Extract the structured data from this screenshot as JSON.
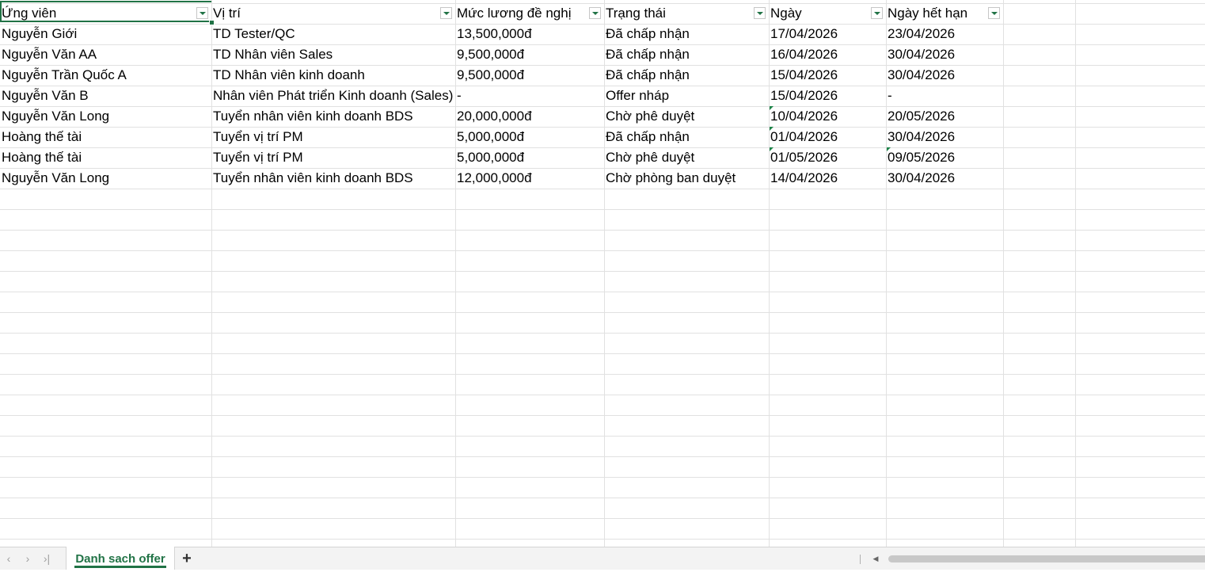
{
  "headers": [
    {
      "label": "Ứng viên"
    },
    {
      "label": "Vị trí"
    },
    {
      "label": "Mức lương đề nghị"
    },
    {
      "label": "Trạng thái"
    },
    {
      "label": "Ngày"
    },
    {
      "label": "Ngày hết hạn"
    }
  ],
  "rows": [
    {
      "cells": [
        "Nguyễn Giới",
        "TD Tester/QC",
        "13,500,000đ",
        "Đã chấp nhận",
        "17/04/2026",
        "23/04/2026"
      ]
    },
    {
      "cells": [
        "Nguyễn Văn AA",
        "TD Nhân viên Sales",
        "9,500,000đ",
        "Đã chấp nhận",
        "16/04/2026",
        "30/04/2026"
      ]
    },
    {
      "cells": [
        "Nguyễn Trần Quốc A",
        "TD Nhân viên kinh doanh",
        "9,500,000đ",
        "Đã chấp nhận",
        "15/04/2026",
        "30/04/2026"
      ]
    },
    {
      "cells": [
        "Nguyễn Văn B",
        "Nhân viên Phát triển Kinh doanh (Sales)",
        "-",
        "Offer nháp",
        "15/04/2026",
        "-"
      ]
    },
    {
      "cells": [
        "Nguyễn Văn Long",
        "Tuyển nhân viên kinh doanh BDS",
        "20,000,000đ",
        "Chờ phê duyệt",
        "10/04/2026",
        "20/05/2026"
      ]
    },
    {
      "cells": [
        "Hoàng thế tài",
        "Tuyển vị trí PM",
        "5,000,000đ",
        "Đã chấp nhận",
        "01/04/2026",
        "30/04/2026"
      ]
    },
    {
      "cells": [
        "Hoàng thế tài",
        "Tuyển vị trí PM",
        "5,000,000đ",
        "Chờ phê duyệt",
        "01/05/2026",
        "09/05/2026"
      ]
    },
    {
      "cells": [
        "Nguyễn Văn Long",
        "Tuyển nhân viên kinh doanh BDS",
        "12,000,000đ",
        "Chờ phòng ban duyệt",
        "14/04/2026",
        "30/04/2026"
      ]
    }
  ],
  "sheet_tab": {
    "label": "Danh sach offer"
  },
  "nav": {
    "first": "‹",
    "prev": "›",
    "last": "›|",
    "add": "+"
  },
  "colors": {
    "accent": "#217346",
    "grid": "#e1e1e1"
  }
}
